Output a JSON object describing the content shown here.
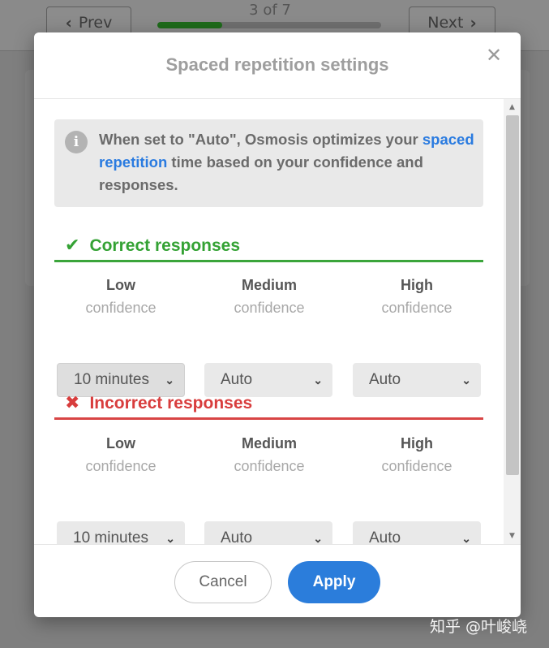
{
  "background": {
    "prev_label": "Prev",
    "next_label": "Next",
    "counter": "3 of 7",
    "progress_fraction": 0.29
  },
  "modal": {
    "title": "Spaced repetition settings",
    "close_glyph": "✕",
    "info": {
      "icon": "info-icon",
      "icon_glyph": "i",
      "text_before": "When set to \"Auto\", Osmosis optimizes your ",
      "link_text": "spaced repetition",
      "text_after": " time based on your confidence and responses."
    },
    "correct": {
      "icon": "check-icon",
      "icon_glyph": "✔",
      "title": "Correct responses",
      "color": "#34a234",
      "columns": [
        {
          "level": "Low",
          "sub": "confidence",
          "value": "10 minutes"
        },
        {
          "level": "Medium",
          "sub": "confidence",
          "value": "Auto"
        },
        {
          "level": "High",
          "sub": "confidence",
          "value": "Auto"
        }
      ]
    },
    "incorrect": {
      "icon": "cross-icon",
      "icon_glyph": "✖",
      "title": "Incorrect responses",
      "color": "#d83d3d",
      "columns": [
        {
          "level": "Low",
          "sub": "confidence",
          "value": "10 minutes"
        },
        {
          "level": "Medium",
          "sub": "confidence",
          "value": "Auto"
        },
        {
          "level": "High",
          "sub": "confidence",
          "value": "Auto"
        }
      ]
    },
    "cancel_label": "Cancel",
    "apply_label": "Apply",
    "accent_color": "#2b7ddb"
  },
  "watermark": "知乎 @叶峻峣"
}
